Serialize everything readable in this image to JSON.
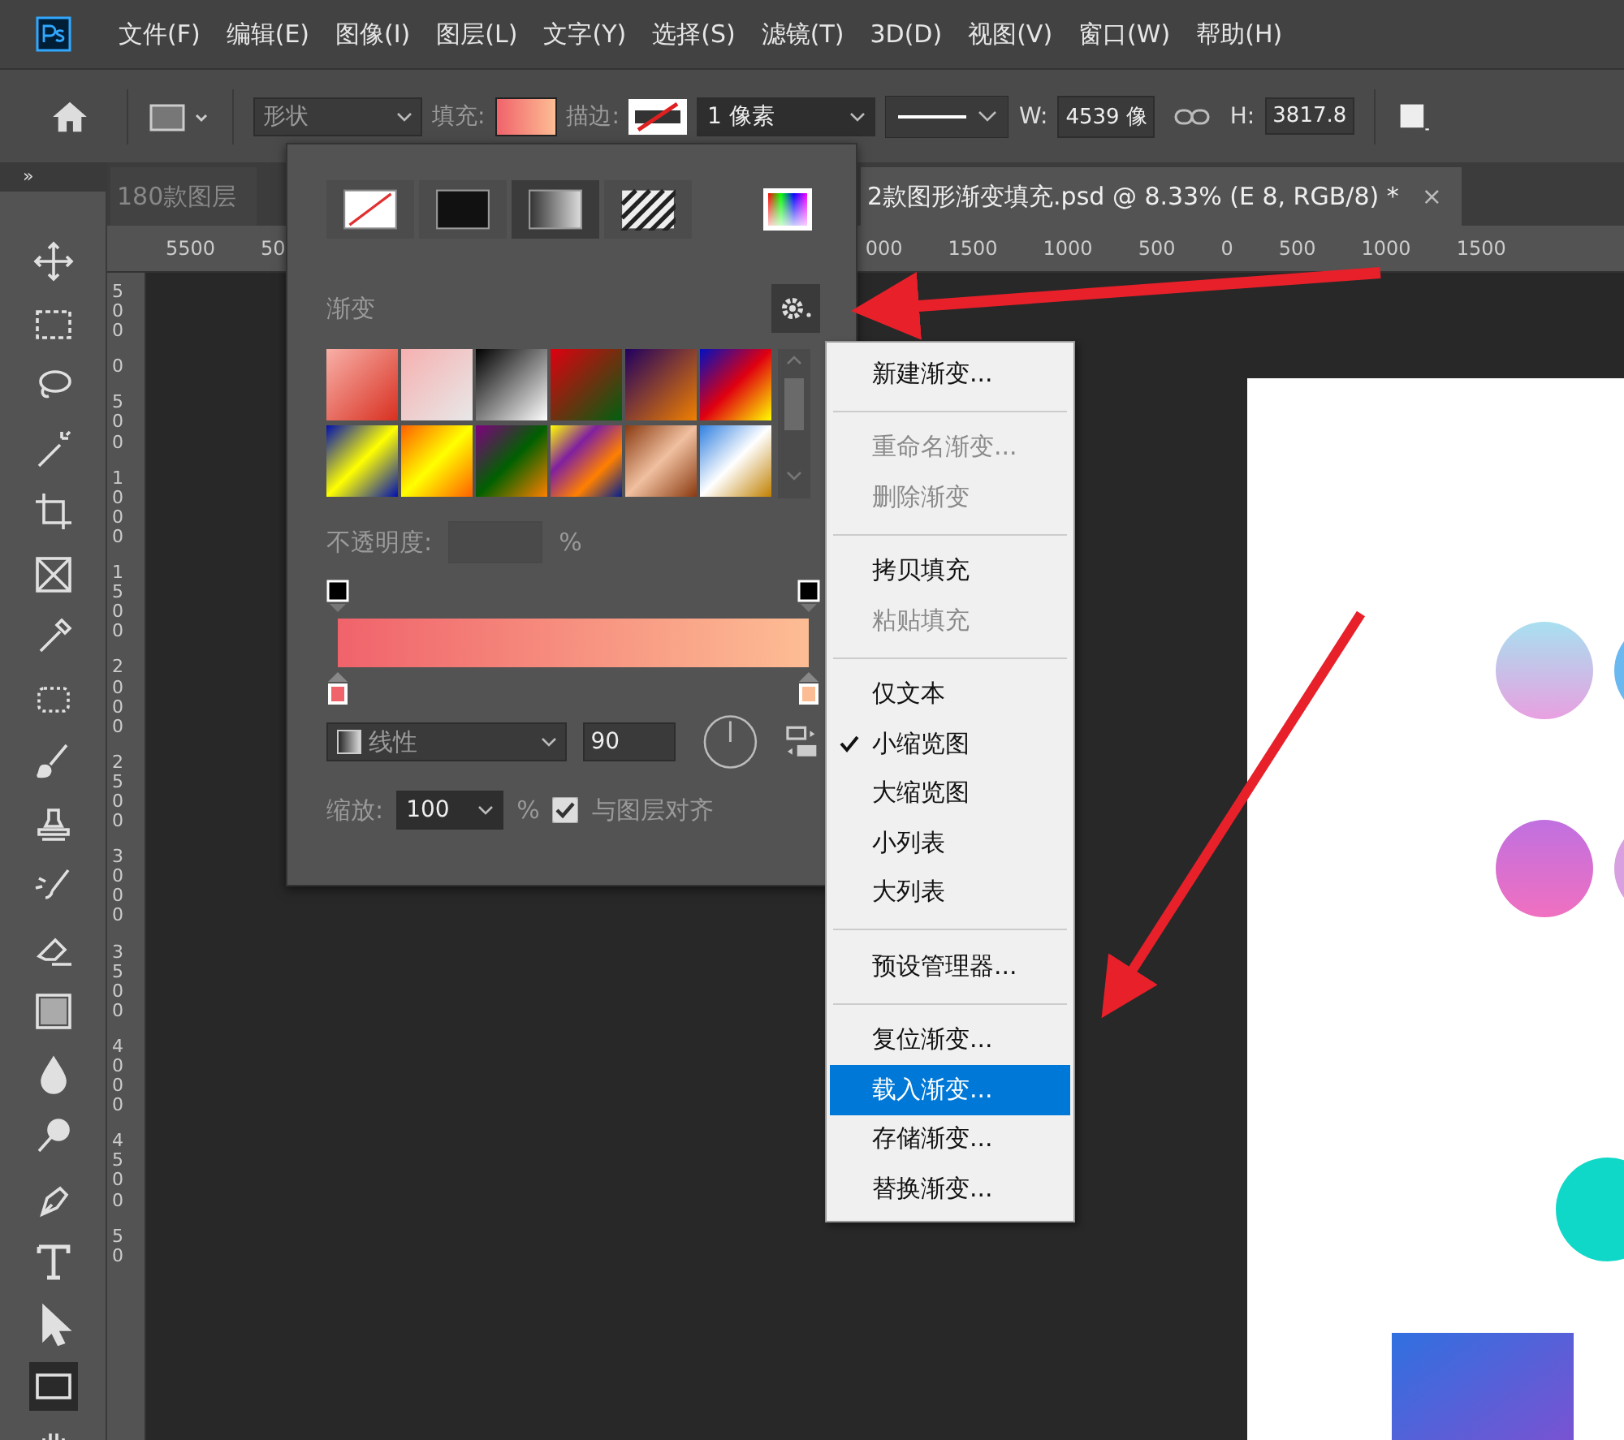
{
  "menu_bar": [
    "文件(F)",
    "编辑(E)",
    "图像(I)",
    "图层(L)",
    "文字(Y)",
    "选择(S)",
    "滤镜(T)",
    "3D(D)",
    "视图(V)",
    "窗口(W)",
    "帮助(H)"
  ],
  "options_bar": {
    "mode": "形状",
    "fill_label": "填充:",
    "stroke_label": "描边:",
    "stroke_width": "1 像素",
    "w_label": "W:",
    "w_value": "4539 像",
    "h_label": "H:",
    "h_value": "3817.8"
  },
  "panel_toggle": "»",
  "tabs": [
    {
      "title": "180款图层",
      "selected": false
    },
    {
      "title": "2款图形渐变填充.psd @ 8.33% (E 8, RGB/8) *",
      "selected": true,
      "close": "×"
    }
  ],
  "h_ruler": [
    "5500",
    "50",
    "000",
    "1500",
    "1000",
    "500",
    "0",
    "500",
    "1000",
    "1500"
  ],
  "v_ruler": [
    "500",
    "0",
    "500",
    "1000",
    "1500",
    "2000",
    "2500",
    "3000",
    "3500",
    "4000",
    "4500",
    "50"
  ],
  "tools": [
    {
      "kind": "move",
      "selected": false
    },
    {
      "kind": "marquee",
      "selected": false
    },
    {
      "kind": "lasso",
      "selected": false
    },
    {
      "kind": "wand",
      "selected": false
    },
    {
      "kind": "crop",
      "selected": false
    },
    {
      "kind": "frame",
      "selected": false
    },
    {
      "kind": "eyedropper",
      "selected": false
    },
    {
      "kind": "patch",
      "selected": false
    },
    {
      "kind": "brush",
      "selected": false
    },
    {
      "kind": "stamp",
      "selected": false
    },
    {
      "kind": "history",
      "selected": false
    },
    {
      "kind": "eraser",
      "selected": false
    },
    {
      "kind": "gradient",
      "selected": false
    },
    {
      "kind": "drop",
      "selected": false
    },
    {
      "kind": "dodge",
      "selected": false
    },
    {
      "kind": "pen",
      "selected": false
    },
    {
      "kind": "type",
      "selected": false
    },
    {
      "kind": "select",
      "selected": false
    },
    {
      "kind": "rect",
      "selected": true
    },
    {
      "kind": "hand",
      "selected": false
    }
  ],
  "gradient_panel": {
    "fill_types": [
      {
        "kind": "none",
        "selected": false
      },
      {
        "kind": "solid",
        "selected": false
      },
      {
        "kind": "gradient",
        "selected": true
      },
      {
        "kind": "pattern",
        "selected": false
      }
    ],
    "title": "渐变",
    "opacity_label": "不透明度:",
    "opacity_unit": "%",
    "style": "线性",
    "angle": "90",
    "scale_label": "缩放:",
    "scale": "100",
    "scale_unit": "%",
    "align": {
      "label": "与图层对齐",
      "checked": true
    }
  },
  "context_menu": [
    [
      {
        "label": "新建渐变...",
        "disabled": false,
        "checked": false,
        "selected": false
      }
    ],
    [
      {
        "label": "重命名渐变...",
        "disabled": true,
        "checked": false,
        "selected": false
      },
      {
        "label": "删除渐变",
        "disabled": true,
        "checked": false,
        "selected": false
      }
    ],
    [
      {
        "label": "拷贝填充",
        "disabled": false,
        "checked": false,
        "selected": false
      },
      {
        "label": "粘贴填充",
        "disabled": true,
        "checked": false,
        "selected": false
      }
    ],
    [
      {
        "label": "仅文本",
        "disabled": false,
        "checked": false,
        "selected": false
      },
      {
        "label": "小缩览图",
        "disabled": false,
        "checked": true,
        "selected": false
      },
      {
        "label": "大缩览图",
        "disabled": false,
        "checked": false,
        "selected": false
      },
      {
        "label": "小列表",
        "disabled": false,
        "checked": false,
        "selected": false
      },
      {
        "label": "大列表",
        "disabled": false,
        "checked": false,
        "selected": false
      }
    ],
    [
      {
        "label": "预设管理器...",
        "disabled": false,
        "checked": false,
        "selected": false
      }
    ],
    [
      {
        "label": "复位渐变...",
        "disabled": false,
        "checked": false,
        "selected": false
      },
      {
        "label": "载入渐变...",
        "disabled": false,
        "checked": false,
        "selected": true
      },
      {
        "label": "存储渐变...",
        "disabled": false,
        "checked": false,
        "selected": false
      },
      {
        "label": "替换渐变...",
        "disabled": false,
        "checked": false,
        "selected": false
      }
    ]
  ]
}
